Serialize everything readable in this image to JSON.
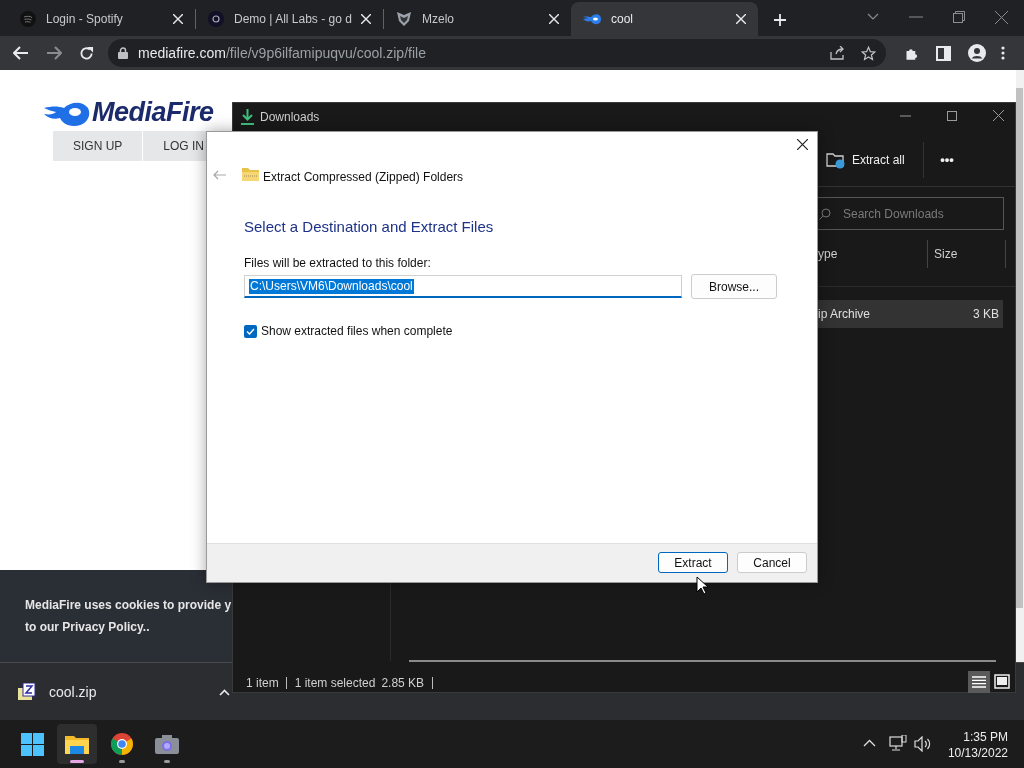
{
  "browser": {
    "tabs": [
      {
        "title": "Login - Spotify",
        "kind": "spotify",
        "selected": false
      },
      {
        "title": "Demo | All Labs - go d",
        "kind": "labs",
        "selected": false
      },
      {
        "title": "Mzelo",
        "kind": "mzelo",
        "selected": false
      },
      {
        "title": "cool",
        "kind": "mediafire",
        "selected": true
      }
    ],
    "url_host": "mediafire.com",
    "url_path": "/file/v9p6ilfamipuqvu/cool.zip/file"
  },
  "page": {
    "logo": "MediaFire",
    "nav": [
      "SIGN UP",
      "LOG IN"
    ],
    "cookie_lines": [
      "MediaFire uses cookies to provide y",
      "to our Privacy Policy.."
    ]
  },
  "download_shelf": {
    "file": "cool.zip"
  },
  "explorer": {
    "title": "Downloads",
    "toolbar": "Extract all",
    "more": "•••",
    "search": {
      "placeholder": "Search Downloads"
    },
    "columns": [
      "ype",
      "Size"
    ],
    "rows": [
      {
        "cells": [
          "ip Archive",
          "3 KB"
        ],
        "selected": true
      }
    ],
    "status": [
      "1 item",
      "1 item selected",
      "2.85 KB"
    ]
  },
  "dialog": {
    "title": "Extract Compressed (Zipped) Folders",
    "heading": "Select a Destination and Extract Files",
    "field_label": "Files will be extracted to this folder:",
    "path": {
      "value": "C:\\Users\\VM6\\Downloads\\cool",
      "selected": true
    },
    "browse": "Browse...",
    "show_files": {
      "label": "Show extracted files when complete",
      "checked": true
    },
    "buttons": [
      {
        "label": "Extract",
        "kind": "default"
      },
      {
        "label": "Cancel",
        "kind": "normal"
      }
    ]
  },
  "taskbar": {
    "apps": [
      {
        "kind": "explorer",
        "selected": true
      },
      {
        "kind": "chrome",
        "selected": false
      },
      {
        "kind": "camera",
        "selected": false
      }
    ],
    "time": "1:35 PM",
    "date": "10/13/2022"
  }
}
